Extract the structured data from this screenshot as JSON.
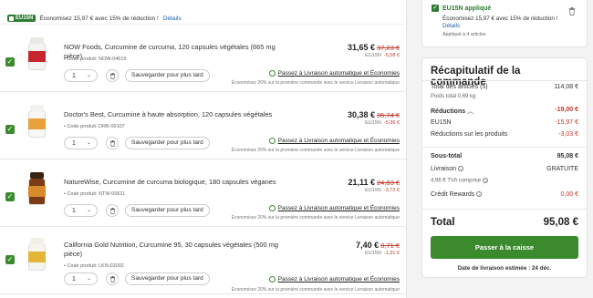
{
  "promo": {
    "badge": "EU15N",
    "text": "Économisez 15,97 € avec 15% de réduction !",
    "details": "Détails"
  },
  "items": [
    {
      "title": "NOW Foods, Curcumine de curcuma, 120 capsules végétales (665 mg pièce)",
      "code": "• Code produit: NOW-04619",
      "qty": "1",
      "save_later": "Sauvegarder pour plus tard",
      "price": "31,65 €",
      "old_price": "37,23 €",
      "promo_code": "EU15N",
      "discount": "-5,58 €",
      "autoship": "Passez à Livraison automatique et Économies",
      "autoship_note": "Économisez 20% sur la première commande avec le service Livraison automatique",
      "colors": {
        "bottle": "#f4f4f0",
        "cap": "#e9e9e4",
        "label": "#c6262e"
      }
    },
    {
      "title": "Doctor's Best, Curcumine à haute absorption, 120 capsules végétales",
      "code": "• Code produit: DRB-00107",
      "qty": "1",
      "save_later": "Sauvegarder pour plus tard",
      "price": "30,38 €",
      "old_price": "35,74 €",
      "promo_code": "EU15N",
      "discount": "-5,36 €",
      "autoship": "Passez à Livraison automatique et Économies",
      "autoship_note": "Économisez 20% sur la première commande avec le service Livraison automatique",
      "colors": {
        "bottle": "#f7f7f5",
        "cap": "#f2f2ee",
        "label": "#e8a13b"
      }
    },
    {
      "title": "NatureWise, Curcumine de curcuma biologique, 180 capsules véganes",
      "code": "• Code produit: NTW-00611",
      "qty": "1",
      "save_later": "Sauvegarder pour plus tard",
      "price": "21,11 €",
      "old_price": "24,83 €",
      "promo_code": "EU15N",
      "discount": "-3,72 €",
      "autoship": "Passez à Livraison automatique et Économies",
      "autoship_note": "Économisez 20% sur la première commande avec le service Livraison automatique",
      "colors": {
        "bottle": "#7a3b15",
        "cap": "#3b2314",
        "label": "#d98b2b"
      }
    },
    {
      "title": "California Gold Nutrition, Curcumine 95, 30 capsules végétales (500 mg pièce)",
      "code": "• Code produit: LKN-02002",
      "qty": "1",
      "save_later": "Sauvegarder pour plus tard",
      "price": "7,40 €",
      "old_price": "8,71 €",
      "promo_code": "EU15N",
      "discount": "-1,31 €",
      "autoship": "Passez à Livraison automatique et Économies",
      "autoship_note": "Économisez 20% sur la première commande avec le service Livraison automatique",
      "colors": {
        "bottle": "#f6f4ee",
        "cap": "#f1efe8",
        "label": "#e5b53a"
      }
    }
  ],
  "coupon": {
    "code": "EU15N appliqué",
    "desc": "Économisez 15,97 € avec 15% de réduction !",
    "details": "Détails",
    "applied": "Appliqué à 4 articles"
  },
  "summary": {
    "title": "Récapitulatif de la commande",
    "subtotal_label": "Total des articles (5)",
    "subtotal_value": "114,08 €",
    "weight": "Poids total 0,69 kg",
    "reductions_label": "Réductions",
    "reductions_value": "-19,00 €",
    "coupon_label": "EU15N",
    "coupon_value": "-15,97 €",
    "product_red_label": "Réductions sur les produits",
    "product_red_value": "-3,03 €",
    "sous_total_label": "Sous-total",
    "sous_total_value": "95,08 €",
    "shipping_label": "Livraison",
    "shipping_value": "GRATUITE",
    "vat": "4,96 € TVA comprise",
    "credit_label": "Crédit Rewards",
    "credit_value": "0,00 €",
    "total_label": "Total",
    "total_value": "95,08 €",
    "checkout": "Passer à la caisse",
    "delivery": "Date de livraison estimée : 24 déc."
  }
}
